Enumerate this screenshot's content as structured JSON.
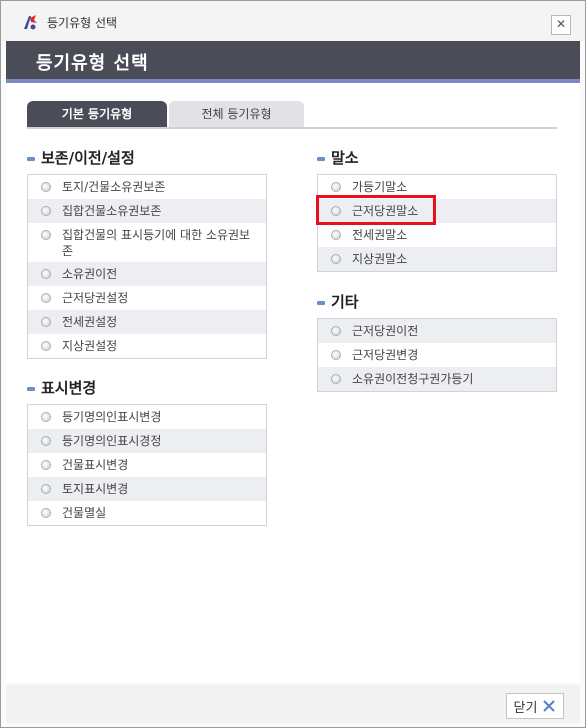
{
  "window": {
    "title": "등기유형 선택"
  },
  "header": {
    "title": "등기유형 선택"
  },
  "tabs": [
    {
      "label": "기본 등기유형",
      "active": true
    },
    {
      "label": "전체 등기유형",
      "active": false
    }
  ],
  "sections": {
    "preserve": {
      "title": "보존/이전/설정",
      "items": [
        "토지/건물소유권보존",
        "집합건물소유권보존",
        "집합건물의 표시등기에 대한 소유권보존",
        "소유권이전",
        "근저당권설정",
        "전세권설정",
        "지상권설정"
      ]
    },
    "display": {
      "title": "표시변경",
      "items": [
        "등기명의인표시변경",
        "등기명의인표시경정",
        "건물표시변경",
        "토지표시변경",
        "건물멸실"
      ]
    },
    "cancel": {
      "title": "말소",
      "items": [
        "가등기말소",
        "근저당권말소",
        "전세권말소",
        "지상권말소"
      ]
    },
    "etc": {
      "title": "기타",
      "items": [
        "근저당권이전",
        "근저당권변경",
        "소유권이전청구권가등기"
      ]
    }
  },
  "footer": {
    "close_label": "닫기"
  },
  "colors": {
    "header_bg": "#4a4c58",
    "accent": "#6d8fc9",
    "highlight": "#e8101a"
  }
}
